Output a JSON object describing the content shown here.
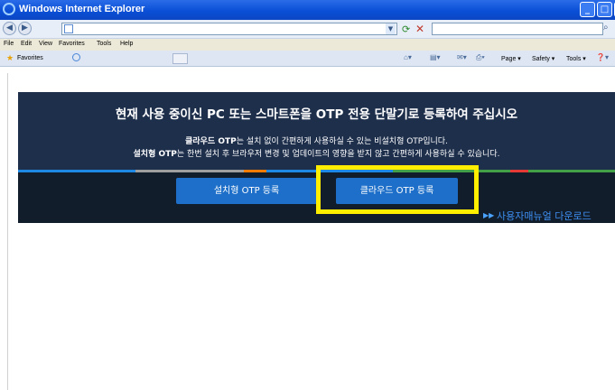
{
  "window": {
    "title": "Windows Internet Explorer"
  },
  "address": {
    "url": "",
    "search_placeholder": ""
  },
  "menu": {
    "items": [
      "File",
      "Edit",
      "View",
      "Favorites",
      "Tools",
      "Help"
    ]
  },
  "favorites_bar": {
    "favorites_label": "Favorites",
    "commands": [
      "Page ▾",
      "Safety ▾",
      "Tools ▾"
    ]
  },
  "banner": {
    "headline": "현재 사용 중이신 PC 또는 스마트폰을 OTP 전용 단말기로 등록하여 주십시오",
    "desc1_bold": "클라우드 OTP",
    "desc1_rest": "는 설치 없이 간편하게 사용하실 수 있는 비설치형 OTP입니다.",
    "desc2_bold": "설치형 OTP",
    "desc2_rest": "는 한번 설치 후 브라우저 변경 및 업데이트의 영향을 받지 않고 간편하게 사용하실 수 있습니다.",
    "band_colors": [
      "#1e88e5",
      "#9e9e9e",
      "#f57c00",
      "#1e88e5",
      "#43a047",
      "#e53935",
      "#43a047"
    ]
  },
  "buttons": {
    "install_otp": "설치형 OTP 등록",
    "cloud_otp": "클라우드 OTP 등록"
  },
  "manual": {
    "label": "사용자매뉴얼 다운로드"
  },
  "colors": {
    "highlight": "#ffee00",
    "banner_bg": "#1e2f4c",
    "button_bg": "#1d6fc9"
  }
}
